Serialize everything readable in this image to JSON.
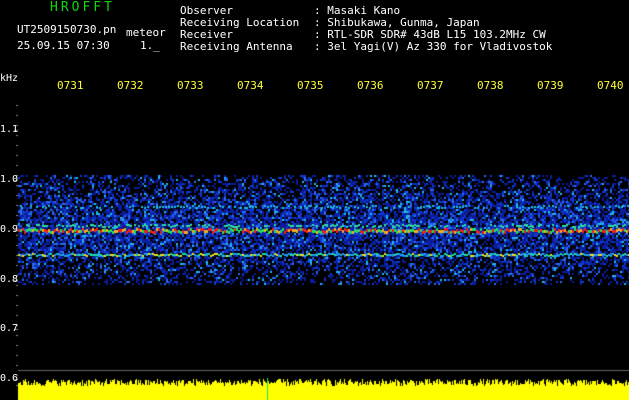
{
  "header": {
    "title": "HROFFT",
    "filename": "UT2509150730.pn",
    "mode": "meteor",
    "datetime": "25.09.15 07:30",
    "count": "1._"
  },
  "info": [
    {
      "label": "Observer",
      "value": ": Masaki Kano"
    },
    {
      "label": "Receiving Location",
      "value": ": Shibukawa, Gunma, Japan"
    },
    {
      "label": "Receiver",
      "value": ": RTL-SDR SDR# 43dB L15 103.2MHz CW"
    },
    {
      "label": "Receiving Antenna",
      "value": ": 3el Yagi(V) Az 330 for Vladivostok"
    }
  ],
  "axis": {
    "unit": "kHz",
    "time_ticks": [
      "0731",
      "0732",
      "0733",
      "0734",
      "0735",
      "0736",
      "0737",
      "0738",
      "0739",
      "0740"
    ],
    "freq_ticks": [
      "1.1",
      "1.0",
      "0.9",
      "0.8",
      "0.7",
      "0.6"
    ]
  },
  "colors": {
    "background": "#000000",
    "title": "#10d810",
    "time_ticks": "#ffff33",
    "text": "#ffffff",
    "bottom_bars": "#ffff00"
  }
}
